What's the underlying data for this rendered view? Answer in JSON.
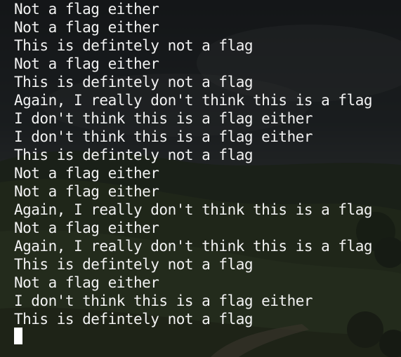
{
  "terminal": {
    "lines": [
      "Not a flag either",
      "Not a flag either",
      "This is defintely not a flag",
      "Not a flag either",
      "This is defintely not a flag",
      "Again, I really don't think this is a flag",
      "I don't think this is a flag either",
      "I don't think this is a flag either",
      "This is defintely not a flag",
      "Not a flag either",
      "Not a flag either",
      "Again, I really don't think this is a flag",
      "Not a flag either",
      "Again, I really don't think this is a flag",
      "This is defintely not a flag",
      "Not a flag either",
      "I don't think this is a flag either",
      "This is defintely not a flag"
    ],
    "text_color": "#f2f2f2",
    "cursor_color": "#ffffff"
  }
}
